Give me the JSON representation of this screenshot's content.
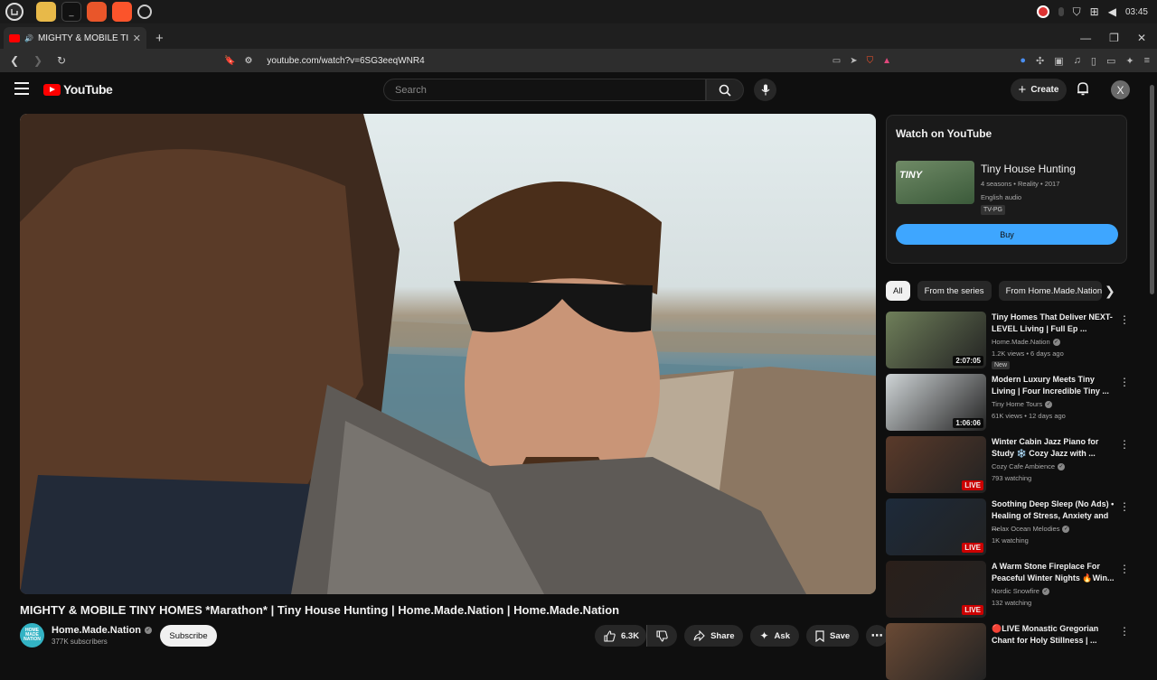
{
  "os_bar": {
    "clock": "03:45"
  },
  "browser": {
    "tab_title": "MIGHTY & MOBILE TINY H",
    "url": "youtube.com/watch?v=6SG3eeqWNR4"
  },
  "youtube_header": {
    "logo": "YouTube",
    "search_placeholder": "Search",
    "create_label": "Create",
    "avatar_letter": "X"
  },
  "video": {
    "title": "MIGHTY & MOBILE TINY HOMES *Marathon* | Tiny House Hunting | Home.Made.Nation | Home.Made.Nation",
    "channel_name": "Home.Made.Nation",
    "subscribers": "377K subscribers",
    "subscribe_label": "Subscribe",
    "likes": "6.3K",
    "share_label": "Share",
    "ask_label": "Ask",
    "save_label": "Save"
  },
  "watch_panel": {
    "heading": "Watch on YouTube",
    "thumb_text": "TINY",
    "show_title": "Tiny House Hunting",
    "meta": "4 seasons • Reality • 2017",
    "audio": "English audio",
    "rating": "TV-PG",
    "buy_label": "Buy"
  },
  "chips": [
    "All",
    "From the series",
    "From Home.Made.Nation"
  ],
  "related": [
    {
      "title": "Tiny Homes That Deliver NEXT-LEVEL Living | Full Ep ...",
      "channel": "Home.Made.Nation",
      "stats": "1.2K views • 6 days ago",
      "badge": "2:07:05",
      "tag": "New",
      "thumb_color": "#6f7f5a"
    },
    {
      "title": "Modern Luxury Meets Tiny Living | Four Incredible Tiny ...",
      "channel": "Tiny Home Tours",
      "stats": "61K views • 12 days ago",
      "badge": "1:06:06",
      "tag": "",
      "thumb_color": "#cfd4d6"
    },
    {
      "title": "Winter Cabin Jazz Piano for Study ❄️ Cozy Jazz with ...",
      "channel": "Cozy Cafe Ambience",
      "stats": "793 watching",
      "badge": "LIVE",
      "tag": "",
      "thumb_color": "#5a3a2a"
    },
    {
      "title": "Soothing Deep Sleep (No Ads) • Healing of Stress, Anxiety and ...",
      "channel": "Relax Ocean Melodies",
      "stats": "1K watching",
      "badge": "LIVE",
      "tag": "",
      "thumb_color": "#1d2a3a"
    },
    {
      "title": "A Warm Stone Fireplace For Peaceful Winter Nights 🔥Win...",
      "channel": "Nordic Snowfire",
      "stats": "132 watching",
      "badge": "LIVE",
      "tag": "",
      "thumb_color": "#2a1f1a"
    },
    {
      "title": "🔴LIVE Monastic Gregorian Chant for Holy Stillness | ...",
      "channel": "",
      "stats": "",
      "badge": "",
      "tag": "",
      "thumb_color": "#6a4a35"
    }
  ],
  "colors": {
    "background": "#0f0f0f",
    "youtube_red": "#ff0000",
    "buy_blue": "#3ea6ff",
    "live_red": "#cc0000"
  }
}
